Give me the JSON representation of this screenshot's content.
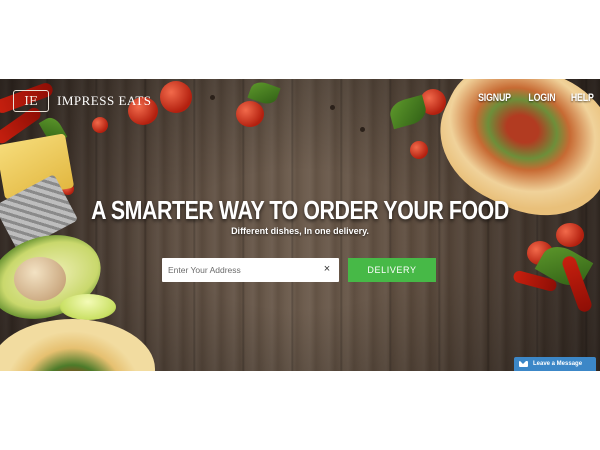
{
  "brand": {
    "emblem": "IE",
    "name": "IMPRESS EATS",
    "tagline_small": ""
  },
  "nav": {
    "items": [
      {
        "label": "SIGNUP"
      },
      {
        "label": "LOGIN"
      },
      {
        "label": "HELP"
      }
    ]
  },
  "hero": {
    "headline": "A SMARTER WAY TO ORDER YOUR FOOD",
    "subheadline": "Different dishes, In one delivery."
  },
  "search": {
    "value": "",
    "placeholder": "Enter Your Address",
    "clear_symbol": "×",
    "button_label": "DELIVERY"
  },
  "chat_widget": {
    "label": "Leave a Message",
    "icon": "envelope-icon"
  },
  "colors": {
    "button_green": "#47b947",
    "chat_blue": "#3c87c7",
    "wood": "#5b4b3e"
  }
}
